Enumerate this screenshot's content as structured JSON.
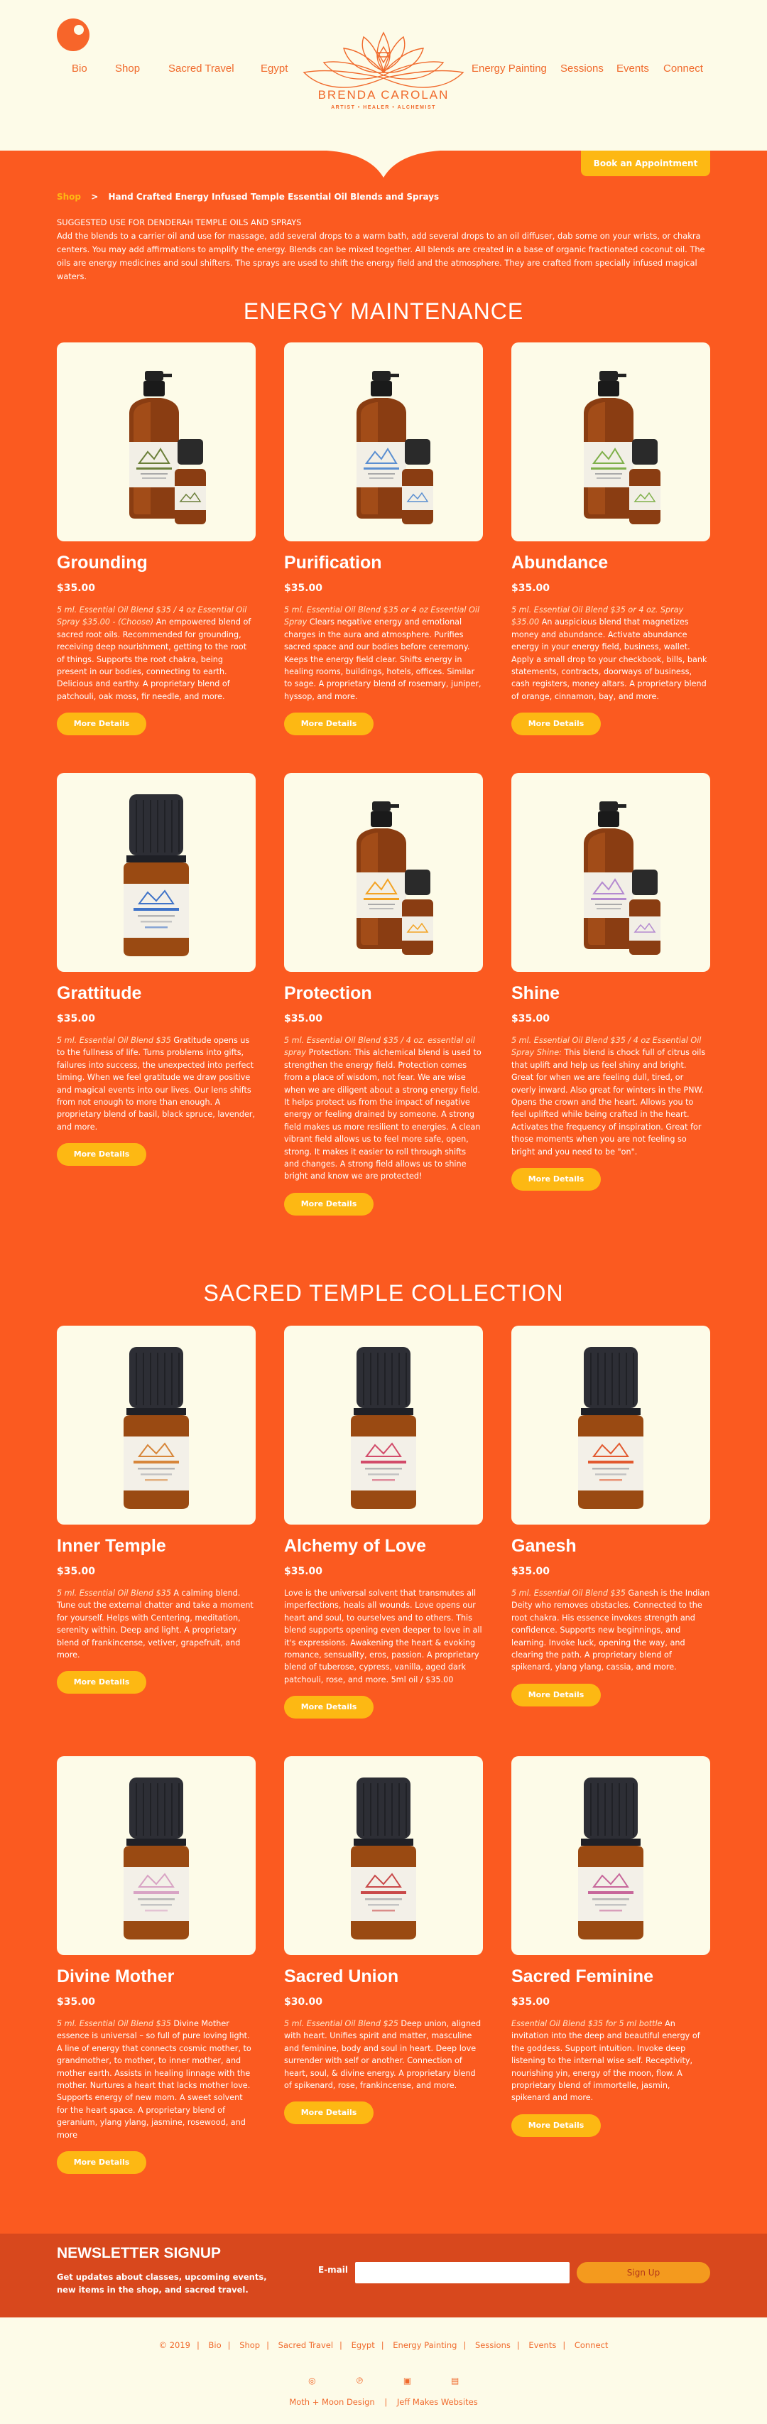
{
  "header": {
    "nav_left": [
      "Bio",
      "Shop",
      "Sacred Travel",
      "Egypt"
    ],
    "nav_right": [
      "Energy Painting",
      "Sessions",
      "Events",
      "Connect"
    ],
    "logo_name": "BRENDA CAROLAN",
    "logo_tagline": "ARTIST • HEALER • ALCHEMIST"
  },
  "book_button": "Book an Appointment",
  "breadcrumb": {
    "shop": "Shop",
    "sep": ">",
    "current": "Hand Crafted Energy Infused Temple Essential Oil Blends and Sprays"
  },
  "intro": {
    "heading": "SUGGESTED USE FOR DENDERAH TEMPLE OILS AND SPRAYS",
    "body": "Add the blends to a carrier oil and use for massage, add several drops to a warm bath, add several drops to an oil diffuser, dab some on your wrists, or chakra centers. You may add affirmations to amplify the energy. Blends can be mixed together. All blends are created in a base of organic fractionated coconut oil. The oils are energy medicines and soul shifters. The sprays are used to shift the energy field and the atmosphere. They are crafted from specially infused magical waters."
  },
  "sections": [
    {
      "title": "ENERGY MAINTENANCE",
      "products": [
        {
          "name": "Grounding",
          "price": "$35.00",
          "label": "GROUNDING",
          "kind": "set",
          "desc_italic": "5 ml. Essential Oil Blend $35 / 4 oz Essential Oil Spray $35.00 - (Choose)",
          "desc": " An empowered blend of sacred root oils. Recommended for grounding, receiving deep nourishment, getting to the root of things. Supports the root chakra, being present in our bodies, connecting to earth. Delicious and earthy. A proprietary blend of patchouli, oak moss, fir needle, and more.",
          "button": "More Details"
        },
        {
          "name": "Purification",
          "price": "$35.00",
          "label": "PURIFICATION",
          "kind": "set",
          "desc_italic": "5 ml. Essential Oil Blend $35 or 4 oz Essential Oil Spray",
          "desc": " Clears negative energy and emotional charges in the aura and atmosphere. Purifies sacred space and our bodies before ceremony. Keeps the energy field clear. Shifts energy in healing rooms, buildings, hotels, offices. Similar to sage. A proprietary blend of rosemary, juniper, hyssop, and more.",
          "button": "More Details"
        },
        {
          "name": "Abundance",
          "price": "$35.00",
          "label": "ABUNDANCE",
          "kind": "set",
          "desc_italic": "5 ml. Essential Oil Blend $35 or 4 oz. Spray $35.00",
          "desc": " An auspicious blend that magnetizes money and abundance. Activate abundance energy in your energy field, business, wallet. Apply a small drop to your checkbook, bills, bank statements, contracts, doorways of business, cash registers, money altars. A proprietary blend of orange, cinnamon, bay, and more.",
          "button": "More Details"
        },
        {
          "name": "Grattitude",
          "price": "$35.00",
          "label": "GRATITUDE",
          "kind": "oil",
          "desc_italic": "5 ml. Essential Oil Blend $35",
          "desc": " Gratitude opens us to the fullness of life. Turns problems into gifts, failures into success, the unexpected into perfect timing. When we feel gratitude we draw positive and magical events into our lives. Our lens shifts from not enough to more than enough. A proprietary blend of basil, black spruce, lavender, and more.",
          "button": "More Details"
        },
        {
          "name": "Protection",
          "price": "$35.00",
          "label": "PROTECTION",
          "kind": "set",
          "desc_italic": "5 ml. Essential Oil Blend $35 / 4 oz. essential oil spray",
          "desc": " Protection: This alchemical blend is used to strengthen the energy field. Protection comes from a place of wisdom, not fear. We are wise when we are diligent about a strong energy field. It helps protect us from the impact of negative energy or feeling drained by someone. A strong field makes us more resilient to energies. A clean vibrant field allows us to feel more safe, open, strong. It makes it easier to roll through shifts and changes. A strong field allows us to shine bright and know we are protected!",
          "button": "More Details"
        },
        {
          "name": "Shine",
          "price": "$35.00",
          "label": "SHINE",
          "kind": "set",
          "desc_italic": "5 ml. Essential Oil Blend $35 / 4 oz Essential Oil Spray Shine:",
          "desc": " This blend is chock full of citrus oils that uplift and help us feel shiny and bright. Great for when we are feeling dull, tired, or overly inward. Also great for winters in the PNW. Opens the crown and the heart. Allows you to feel uplifted while being crafted in the heart. Activates the frequency of inspiration. Great for those moments when you are not feeling so bright and you need to be \"on\".",
          "button": "More Details"
        }
      ]
    },
    {
      "title": "SACRED TEMPLE COLLECTION",
      "products": [
        {
          "name": "Inner Temple",
          "price": "$35.00",
          "label": "INNER TEMPLE",
          "kind": "oil",
          "desc_italic": "5 ml. Essential Oil Blend $35",
          "desc": " A calming blend. Tune out the external chatter and take a moment for yourself. Helps with Centering, meditation, serenity within. Deep and light. A proprietary blend of frankincense, vetiver, grapefruit, and more.",
          "button": "More Details"
        },
        {
          "name": "Alchemy of Love",
          "price": "$35.00",
          "label": "ALCHEMY OF LOVE",
          "kind": "oil",
          "desc_italic": "",
          "desc": "Love is the universal solvent that transmutes all imperfections, heals all wounds. Love opens our heart and soul, to ourselves and to others. This blend supports opening even deeper to love in all it's expressions. Awakening the heart & evoking romance, sensuality, eros, passion. A proprietary blend of tuberose, cypress, vanilla, aged dark patchouli, rose, and more. 5ml oil / $35.00",
          "button": "More Details"
        },
        {
          "name": "Ganesh",
          "price": "$35.00",
          "label": "GANESH",
          "kind": "oil",
          "desc_italic": "5 ml. Essential Oil Blend $35",
          "desc": " Ganesh is the Indian Deity who removes obstacles. Connected to the root chakra. His essence invokes strength and confidence. Supports new beginnings, and learning. Invoke luck, opening the way, and clearing the path. A proprietary blend of spikenard, ylang ylang, cassia, and more.",
          "button": "More Details"
        },
        {
          "name": "Divine Mother",
          "price": "$35.00",
          "label": "DIVINE MOTHER",
          "kind": "oil",
          "desc_italic": "5 ml. Essential Oil Blend $35",
          "desc": " Divine Mother essence is universal – so full of pure loving light. A line of energy that connects cosmic mother, to grandmother, to mother, to inner mother, and mother earth. Assists in healing linnage with the mother. Nurtures a heart that lacks mother love. Supports energy of new mom. A sweet solvent for the heart space. A proprietary blend of geranium, ylang ylang, jasmine, rosewood, and more",
          "button": "More Details"
        },
        {
          "name": "Sacred Union",
          "price": "$30.00",
          "label": "SACRED UNION",
          "kind": "oil",
          "desc_italic": "5 ml. Essential Oil Blend $25",
          "desc": " Deep union, aligned with heart. Unifies spirit and matter, masculine and feminine, body and soul in heart. Deep love surrender with self or another. Connection of heart, soul, & divine energy. A proprietary blend of spikenard, rose, frankincense, and more.",
          "button": "More Details"
        },
        {
          "name": "Sacred Feminine",
          "price": "$35.00",
          "label": "SACRED FEMININE",
          "kind": "oil",
          "desc_italic": " Essential Oil Blend $35 for 5 ml bottle",
          "desc": " An invitation into the deep and beautiful energy of the goddess. Support intuition. Invoke deep listening to the internal wise self. Receptivity, nourishing yin, energy of the moon, flow. A proprietary blend of immortelle, jasmin, spikenard and more.",
          "button": "More Details"
        }
      ]
    }
  ],
  "newsletter": {
    "title": "NEWSLETTER SIGNUP",
    "text": "Get updates about classes, upcoming events, new items in the shop, and sacred travel.",
    "email_label": "E-mail",
    "button": "Sign Up"
  },
  "footer": {
    "links": [
      "© 2019",
      "Bio",
      "Shop",
      "Sacred Travel",
      "Egypt",
      "Energy Painting",
      "Sessions",
      "Events",
      "Connect"
    ],
    "social": [
      "instagram-icon",
      "pinterest-icon",
      "facebook-icon",
      "linkedin-icon"
    ],
    "credits": [
      "Moth + Moon Design",
      "Jeff Makes Websites"
    ]
  },
  "colors": {
    "orange": "#fb5a20",
    "cream": "#fdfbe8",
    "yellow": "#fdb813",
    "dark_orange": "#d8481d"
  }
}
